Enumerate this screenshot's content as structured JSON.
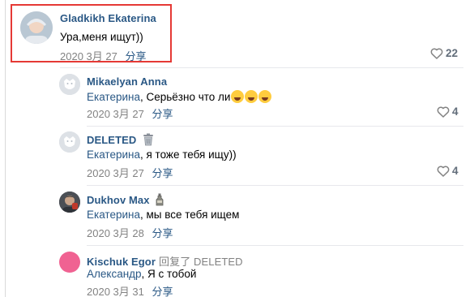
{
  "comments": [
    {
      "author": "Gladkikh Ekaterina",
      "text": "Ура,меня ищут))",
      "date": "2020 3月 27",
      "share": "分享",
      "likes": "22"
    },
    {
      "author": "Mikaelyan Anna",
      "mention": "Екатерина",
      "text": ", Серьёзно что ли",
      "date": "2020 3月 27",
      "share": "分享",
      "likes": "4"
    },
    {
      "author": "DELETED",
      "mention": "Екатерина",
      "text": ", я тоже тебя ищу))",
      "date": "2020 3月 27",
      "share": "分享",
      "likes": "4"
    },
    {
      "author": "Dukhov Max",
      "mention": "Екатерина",
      "text": ", мы все тебя ищем",
      "date": "2020 3月 28",
      "share": "分享"
    },
    {
      "author": "Kischuk Egor",
      "reply_to": "回复了 DELETED",
      "mention": "Александр",
      "text": ", Я с тобой",
      "date": "2020 3月 31",
      "share": "分享"
    }
  ],
  "colors": {
    "link": "#2a5885",
    "meta": "#828282",
    "highlight": "#e53935",
    "avatar_pink": "#f06292"
  },
  "icons": {
    "like": "heart-outline-icon",
    "emoji": "rofl-emoji-icon",
    "trash": "trash-can-icon",
    "bottle": "bottle-icon"
  }
}
